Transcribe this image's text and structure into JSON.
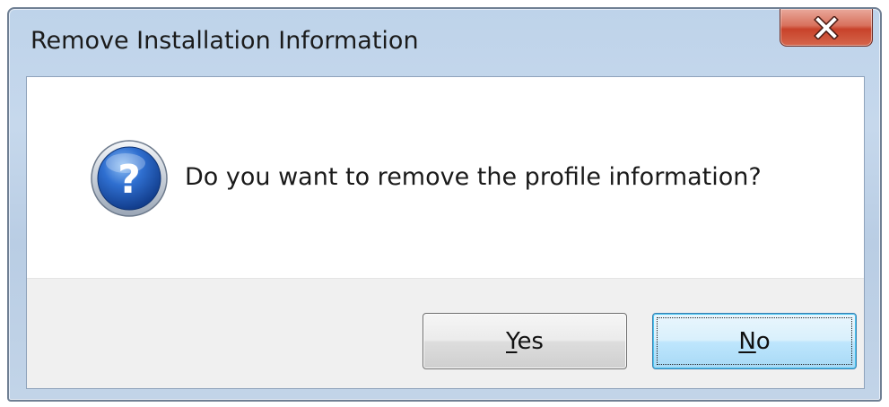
{
  "window": {
    "title": "Remove Installation Information",
    "close_icon": "close-icon"
  },
  "dialog": {
    "icon": "question-icon",
    "message": "Do you want to remove the profile information?"
  },
  "buttons": {
    "yes": {
      "accel": "Y",
      "rest": "es",
      "label": "Yes"
    },
    "no": {
      "accel": "N",
      "rest": "o",
      "label": "No",
      "default": true
    }
  },
  "colors": {
    "title_bar": "#c2d4e8",
    "close_button": "#c8422a",
    "question_icon": "#1f57b3",
    "button_area": "#f0f0f0"
  }
}
